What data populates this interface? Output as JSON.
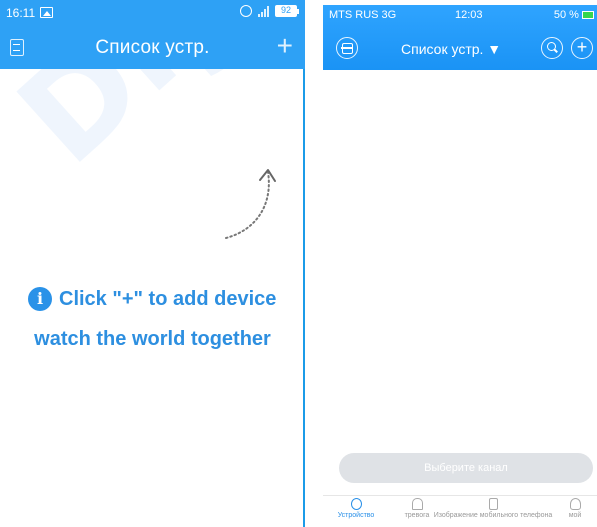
{
  "android": {
    "status_time": "16:11",
    "battery": "92",
    "title": "Список устр.",
    "add_label": "+",
    "hint_line1": "Click \"+\" to add device",
    "hint_line2": "watch the world together",
    "info_glyph": "i",
    "watermark": "Digitek"
  },
  "ios": {
    "carrier": "MTS RUS  3G",
    "time": "12:03",
    "battery": "50 %",
    "title": "Список устр. ▼",
    "add_label": "+",
    "select_button": "Выберите канал",
    "tabs": [
      {
        "label": "Устройство",
        "icon": "camera-icon"
      },
      {
        "label": "тревога",
        "icon": "bell-icon"
      },
      {
        "label": "Изображение мобильного телефона",
        "icon": "tablet-icon"
      },
      {
        "label": "мой",
        "icon": "person-icon"
      }
    ]
  },
  "colors": {
    "header": "#2ea1f5",
    "text_blue": "#2d8fe0",
    "disabled_button": "#dfe2e6"
  }
}
